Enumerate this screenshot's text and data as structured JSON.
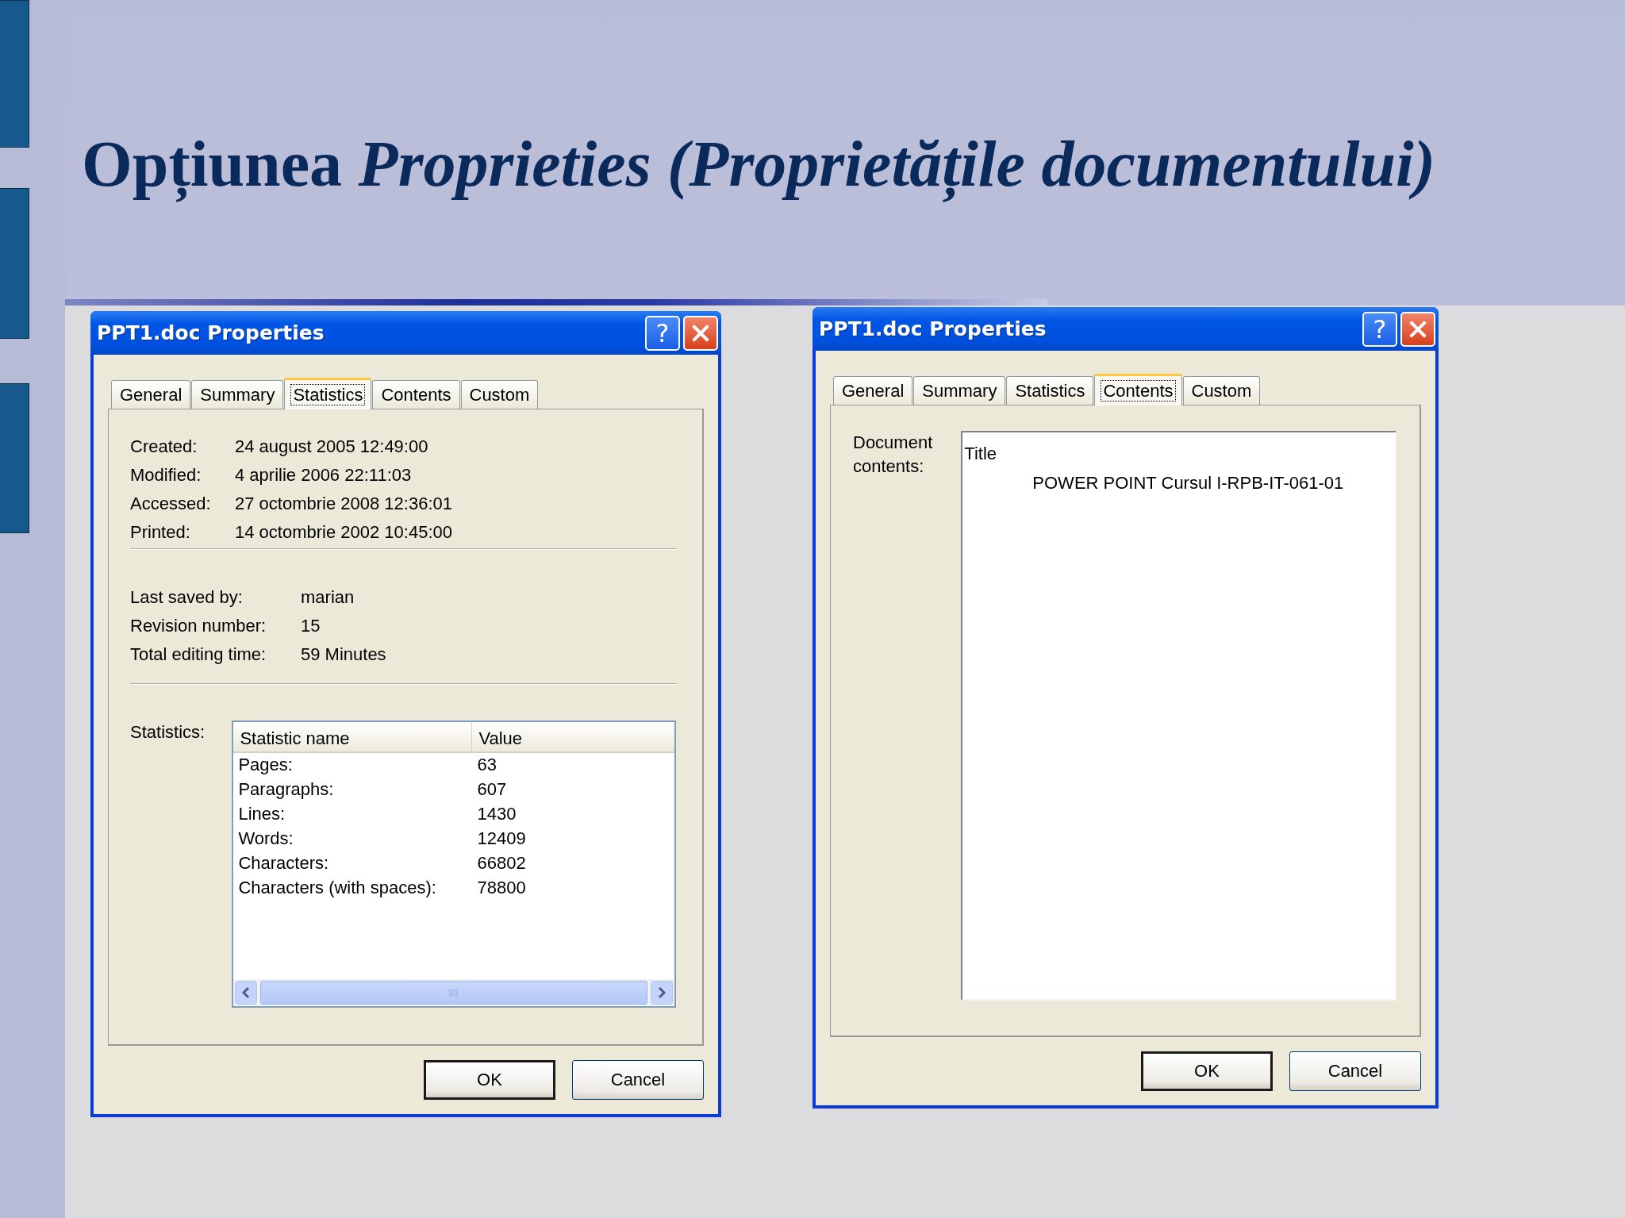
{
  "slide": {
    "title": "Opțiunea *Proprieties (Proprietățile documentului)*"
  },
  "dialogs": [
    {
      "title": "PPT1.doc Properties",
      "help_button": "?",
      "kind": "statistics",
      "tabs": [
        {
          "label": "General",
          "selected": false
        },
        {
          "label": "Summary",
          "selected": false
        },
        {
          "label": "Statistics",
          "selected": true
        },
        {
          "label": "Contents",
          "selected": false
        },
        {
          "label": "Custom",
          "selected": false
        }
      ],
      "dates": [
        {
          "label": "Created:",
          "value": "24 august 2005 12:49:00"
        },
        {
          "label": "Modified:",
          "value": "4 aprilie 2006 22:11:03"
        },
        {
          "label": "Accessed:",
          "value": "27 octombrie 2008 12:36:01"
        },
        {
          "label": "Printed:",
          "value": "14 octombrie 2002 10:45:00"
        }
      ],
      "info": [
        {
          "label": "Last saved by:",
          "value": "marian"
        },
        {
          "label": "Revision number:",
          "value": "15"
        },
        {
          "label": "Total editing time:",
          "value": "59 Minutes"
        }
      ],
      "statistics_label": "Statistics:",
      "table": {
        "columns": [
          "Statistic name",
          "Value"
        ],
        "rows": [
          [
            "Pages:",
            "63"
          ],
          [
            "Paragraphs:",
            "607"
          ],
          [
            "Lines:",
            "1430"
          ],
          [
            "Words:",
            "12409"
          ],
          [
            "Characters:",
            "66802"
          ],
          [
            "Characters (with spaces):",
            "78800"
          ]
        ]
      },
      "buttons": [
        {
          "label": "OK",
          "default": true
        },
        {
          "label": "Cancel",
          "default": false
        }
      ]
    },
    {
      "title": "PPT1.doc Properties",
      "help_button": "?",
      "kind": "contents",
      "tabs": [
        {
          "label": "General",
          "selected": false
        },
        {
          "label": "Summary",
          "selected": false
        },
        {
          "label": "Statistics",
          "selected": false
        },
        {
          "label": "Contents",
          "selected": true
        },
        {
          "label": "Custom",
          "selected": false
        }
      ],
      "contents_label": "Document contents:",
      "contents": [
        {
          "text": "Title",
          "children": [
            {
              "text": "POWER POINT Cursul I-RPB-IT-061-01"
            }
          ]
        }
      ],
      "buttons": [
        {
          "label": "OK",
          "default": true
        },
        {
          "label": "Cancel",
          "default": false
        }
      ]
    }
  ]
}
